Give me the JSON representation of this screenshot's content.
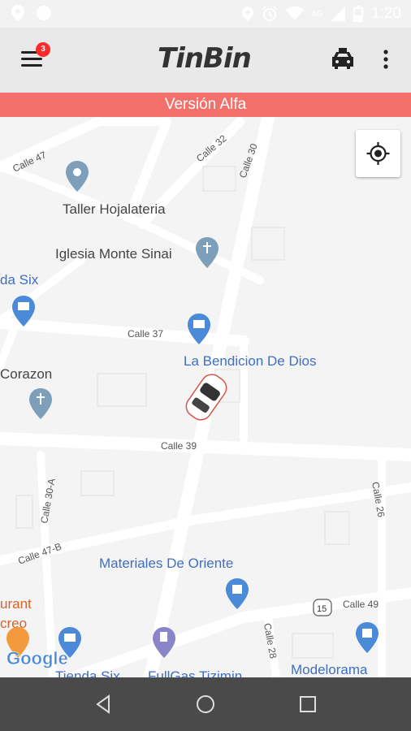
{
  "status_bar": {
    "time": "1:20",
    "network": "4G",
    "icons": [
      "location-icon",
      "circle-icon",
      "location-icon",
      "alarm-icon",
      "wifi-icon",
      "signal-icon",
      "battery-icon"
    ]
  },
  "app_bar": {
    "menu_badge": "3",
    "logo_text": "TinBin",
    "icons": [
      "menu-icon",
      "taxi-icon",
      "more-vert-icon"
    ]
  },
  "version_banner": "Versión Alfa",
  "map": {
    "street_labels": [
      "Calle 47",
      "Calle 32",
      "Calle 30",
      "Calle 37",
      "Calle 39",
      "Calle 30-A",
      "Calle 47-B",
      "Calle 26",
      "Calle 49",
      "Calle 28",
      "15"
    ],
    "places": [
      {
        "name": "Taller Hojalateria",
        "type": "pin"
      },
      {
        "name": "Iglesia Monte Sinai",
        "type": "church"
      },
      {
        "name": "da Six",
        "type": "store"
      },
      {
        "name": "La Bendicion De Dios",
        "type": "store"
      },
      {
        "name": "Corazon",
        "type": "church"
      },
      {
        "name": "Materiales De Oriente",
        "type": "shop"
      },
      {
        "name": "urant",
        "type": "restaurant"
      },
      {
        "name": "creo",
        "type": "restaurant"
      },
      {
        "name": "Tienda Six",
        "type": "store"
      },
      {
        "name": "FullGas Tizimin",
        "type": "gas"
      },
      {
        "name": "Modelorama",
        "type": "shop"
      }
    ],
    "google_logo": "Google"
  },
  "colors": {
    "banner": "#f4706b",
    "badge": "#ff2a2a",
    "poi_blue": "#4a8ad8",
    "nav_bar": "#4a4a4a"
  }
}
